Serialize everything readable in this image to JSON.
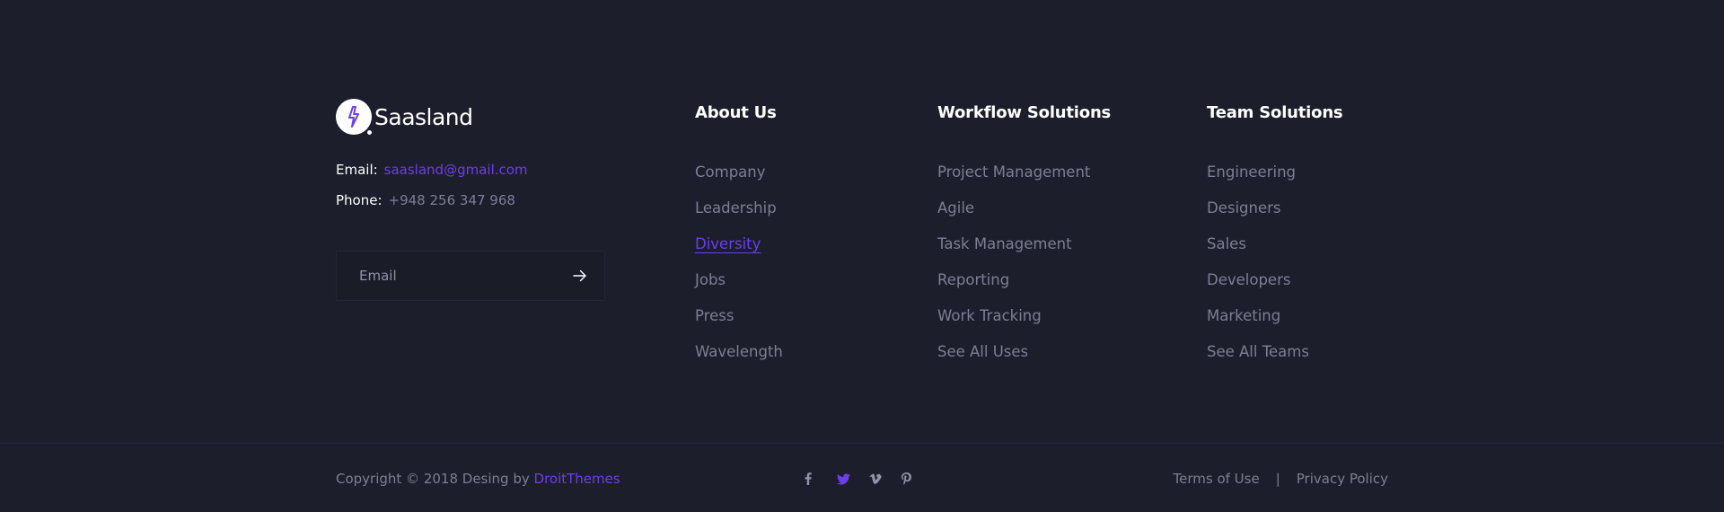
{
  "brand": {
    "name": "Saasland",
    "logo_icon": "lightning-bolt-icon",
    "accent_color": "#6c3fe8"
  },
  "contact": {
    "email_label": "Email:",
    "email_value": "saasland@gmail.com",
    "phone_label": "Phone:",
    "phone_value": "+948 256 347 968"
  },
  "subscribe": {
    "placeholder": "Email",
    "submit_icon": "arrow-right-icon"
  },
  "columns": {
    "about": {
      "title": "About Us",
      "items": [
        "Company",
        "Leadership",
        "Diversity",
        "Jobs",
        "Press",
        "Wavelength"
      ]
    },
    "workflow": {
      "title": "Workflow Solutions",
      "items": [
        "Project Management",
        "Agile",
        "Task Management",
        "Reporting",
        "Work Tracking",
        "See All Uses"
      ]
    },
    "team": {
      "title": "Team Solutions",
      "items": [
        "Engineering",
        "Designers",
        "Sales",
        "Developers",
        "Marketing",
        "See All Teams"
      ]
    }
  },
  "bottom": {
    "copyright_prefix": "Copyright © 2018 Desing by",
    "copyright_brand": "DroitThemes",
    "social": [
      "facebook-icon",
      "twitter-icon",
      "vimeo-icon",
      "pinterest-icon"
    ],
    "terms": "Terms of Use",
    "separator": "|",
    "privacy": "Privacy Policy"
  }
}
